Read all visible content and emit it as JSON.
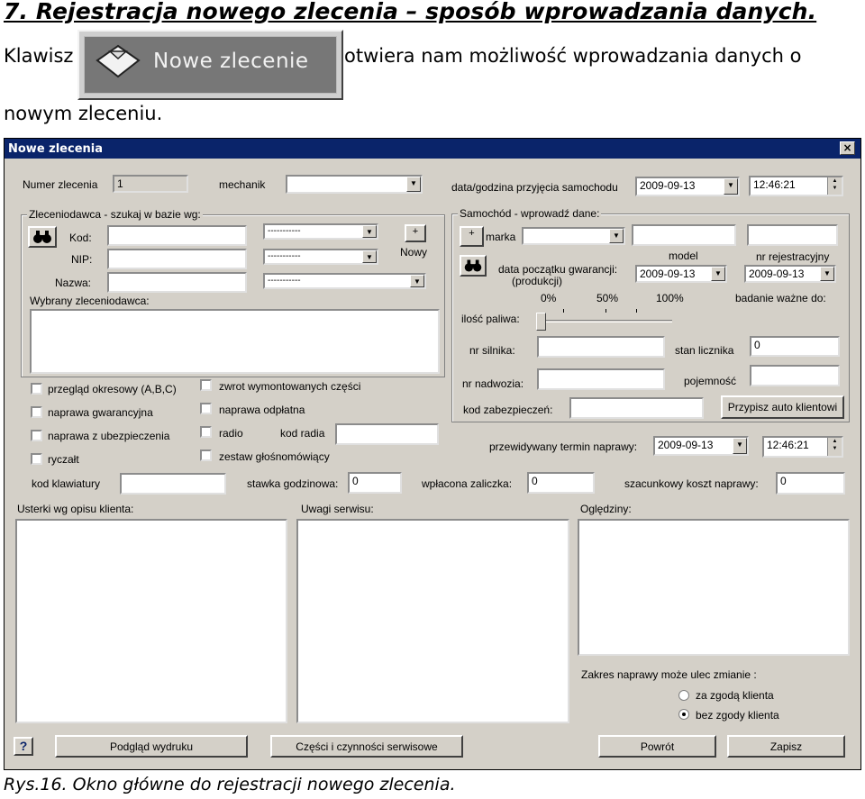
{
  "doc": {
    "heading": "7. Rejestracja nowego zlecenia – sposób wprowadzania danych.",
    "para_start": "Klawisz",
    "para_end": "otwiera nam możliwość wprowadzania danych o",
    "para_line2": "nowym zleceniu.",
    "button_image_label": "Nowe zlecenie",
    "caption": "Rys.16. Okno główne do rejestracji nowego zlecenia."
  },
  "window": {
    "title": "Nowe zlecenia",
    "close": "×"
  },
  "form": {
    "numer_label": "Numer zlecenia",
    "numer_value": "1",
    "mechanik_label": "mechanik",
    "data_label": "data/godzina przyjęcia samochodu",
    "data_value": "2009-09-13",
    "time_value": "12:46:21",
    "client_group": "Zleceniodawca - szukaj w bazie wg:",
    "kod_label": "Kod:",
    "nip_label": "NIP:",
    "nazwa_label": "Nazwa:",
    "dash_value": "-----------",
    "plus": "+",
    "nowy_label": "Nowy",
    "wybrany_label": "Wybrany zleceniodawca:",
    "car_group": "Samochód - wprowadź dane:",
    "marka_label": "marka",
    "model_label": "model",
    "nr_rej_label": "nr rejestracyjny",
    "gwarancja_label1": "data początku gwarancji:",
    "gwarancja_label2": "(produkcji)",
    "gw_date1": "2009-09-13",
    "gw_date2": "2009-09-13",
    "pct0": "0%",
    "pct50": "50%",
    "pct100": "100%",
    "badanie_label": "badanie ważne do:",
    "paliwo_label": "ilość paliwa:",
    "fuel_level": 0,
    "silnik_label": "nr silnika:",
    "licznik_label": "stan licznika",
    "licznik_value": "0",
    "nadwozie_label": "nr nadwozia:",
    "pojemnosc_label": "pojemność",
    "zabezp_label": "kod zabezpieczeń:",
    "przypisz_btn": "Przypisz auto klientowi",
    "chk_przeglad": "przegląd okresowy (A,B,C)",
    "chk_gwarancyjna": "naprawa gwarancyjna",
    "chk_ubezpieczenia": "naprawa z ubezpieczenia",
    "chk_ryczalt": "ryczałt",
    "chk_zwrot": "zwrot wymontowanych części",
    "chk_odplatna": "naprawa odpłatna",
    "chk_radio": "radio",
    "kod_radia_label": "kod radia",
    "chk_zestaw": "zestaw głośnomówiący",
    "termin_label": "przewidywany termin naprawy:",
    "termin_date": "2009-09-13",
    "termin_time": "12:46:21",
    "klawiatury_label": "kod klawiatury",
    "stawka_label": "stawka godzinowa:",
    "stawka_value": "0",
    "zaliczka_label": "wpłacona zaliczka:",
    "zaliczka_value": "0",
    "koszt_label": "szacunkowy koszt naprawy:",
    "koszt_value": "0",
    "usterki_label": "Usterki wg opisu klienta:",
    "uwagi_label": "Uwagi serwisu:",
    "ogledziny_label": "Oględziny:",
    "zakres_label": "Zakres naprawy może ulec zmianie :",
    "radio_za": "za zgodą klienta",
    "radio_bez": "bez zgody klienta",
    "help_btn": "?",
    "podglad_btn": "Podgląd wydruku",
    "czesci_btn": "Części i czynności serwisowe",
    "powrot_btn": "Powrót",
    "zapisz_btn": "Zapisz"
  }
}
